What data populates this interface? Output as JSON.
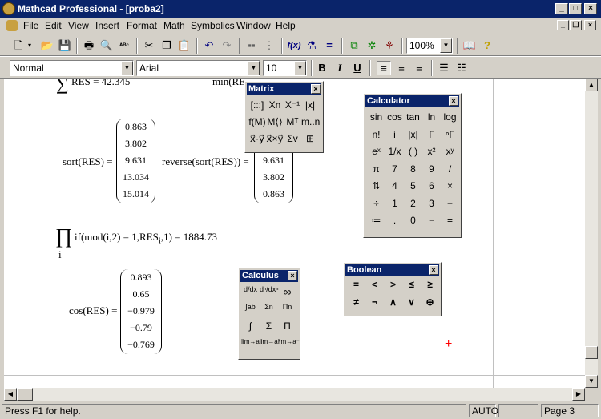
{
  "window": {
    "title": "Mathcad Professional - [proba2]",
    "min": "_",
    "max": "□",
    "close": "×"
  },
  "menu": {
    "items": [
      "File",
      "Edit",
      "View",
      "Insert",
      "Format",
      "Math",
      "Symbolics",
      "Window",
      "Help"
    ]
  },
  "toolbar": {
    "zoom": "100%"
  },
  "format": {
    "style": "Normal",
    "font": "Arial",
    "size": "10",
    "bold": "B",
    "italic": "I",
    "underline": "U"
  },
  "doc": {
    "top_expr": "RES = 42.345",
    "top_right": "min(RE",
    "sort_label": "sort(RES) =",
    "sort_values": [
      "0.863",
      "3.802",
      "9.631",
      "13.034",
      "15.014"
    ],
    "reverse_label": "reverse(sort(RES)) =",
    "reverse_values": [
      "9.631",
      "3.802",
      "0.863"
    ],
    "prod_expr": "if(mod(i,2) = 1,RES",
    "prod_sub": "i",
    "prod_tail": ",1) = 1884.73",
    "prod_index": "i",
    "cos_label": "cos(RES) =",
    "cos_values": [
      "0.893",
      "0.65",
      "−0.979",
      "−0.79",
      "−0.769"
    ],
    "cursor": "+"
  },
  "palettes": {
    "matrix": {
      "title": "Matrix",
      "buttons": [
        "[:::]",
        "Xn",
        "X⁻¹",
        "|x|",
        "f(M)",
        "M⟨⟩",
        "Mᵀ",
        "m..n",
        "x⃗·y⃗",
        "x⃗×y⃗",
        "Σv",
        "⊞"
      ]
    },
    "calculator": {
      "title": "Calculator",
      "buttons": [
        "sin",
        "cos",
        "tan",
        "ln",
        "log",
        "n!",
        "i",
        "|x|",
        "Γ",
        "ⁿΓ",
        "eˣ",
        "1/x",
        "( )",
        "x²",
        "xʸ",
        "π",
        "7",
        "8",
        "9",
        "/",
        "⇅",
        "4",
        "5",
        "6",
        "×",
        "÷",
        "1",
        "2",
        "3",
        "+",
        "≔",
        ".",
        "0",
        "−",
        "="
      ]
    },
    "calculus": {
      "title": "Calculus",
      "buttons": [
        "d/dx",
        "dⁿ/dxⁿ",
        "∞",
        "∫ab",
        "Σn",
        "Πn",
        "∫",
        "Σ",
        "Π",
        "lim→a",
        "lim→a⁺",
        "lim→a⁻"
      ]
    },
    "boolean": {
      "title": "Boolean",
      "buttons": [
        "=",
        "<",
        ">",
        "≤",
        "≥",
        "≠",
        "¬",
        "∧",
        "∨",
        "⊕"
      ]
    }
  },
  "status": {
    "help": "Press F1 for help.",
    "mode": "AUTO",
    "page": "Page 3"
  }
}
